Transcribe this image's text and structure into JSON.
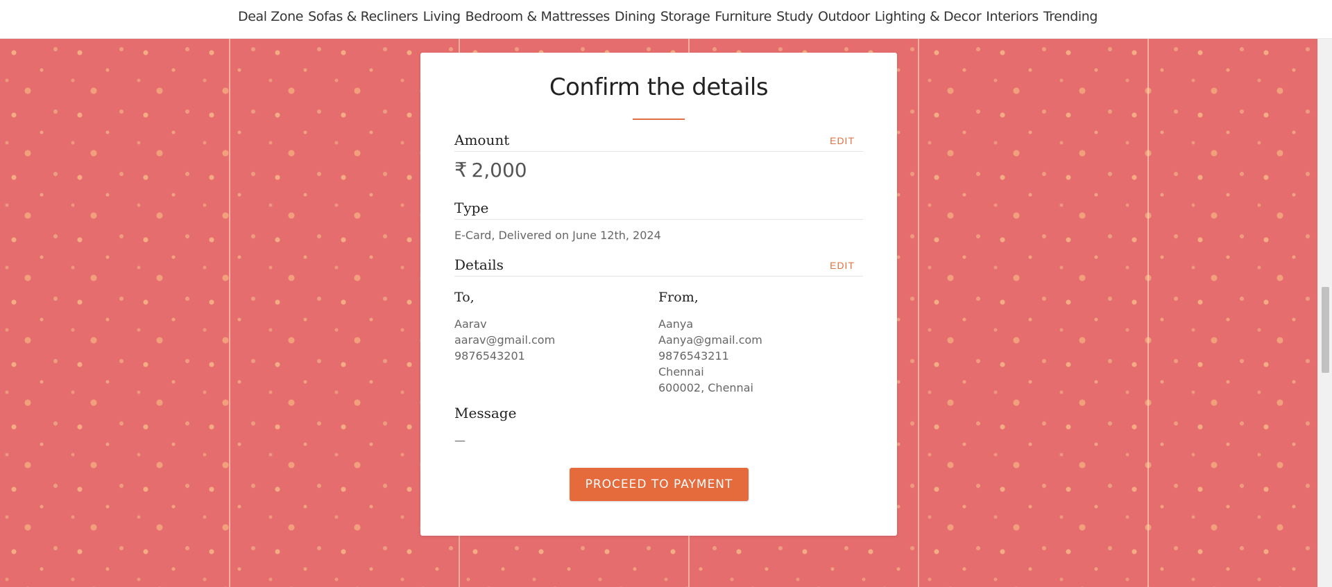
{
  "nav": {
    "items": [
      "Deal Zone",
      "Sofas & Recliners",
      "Living",
      "Bedroom & Mattresses",
      "Dining",
      "Storage",
      "Furniture",
      "Study",
      "Outdoor",
      "Lighting & Decor",
      "Interiors",
      "Trending"
    ]
  },
  "card": {
    "title": "Confirm the details",
    "amount": {
      "label": "Amount",
      "edit": "EDIT",
      "currency_symbol": "₹",
      "value": "2,000"
    },
    "type": {
      "label": "Type",
      "value": "E-Card, Delivered on June 12th, 2024"
    },
    "details": {
      "label": "Details",
      "edit": "EDIT",
      "to": {
        "heading": "To,",
        "lines": [
          "Aarav",
          "aarav@gmail.com",
          "9876543201"
        ]
      },
      "from": {
        "heading": "From,",
        "lines": [
          "Aanya",
          "Aanya@gmail.com",
          "9876543211",
          "Chennai",
          "600002, Chennai"
        ]
      }
    },
    "message": {
      "label": "Message",
      "value": "—"
    },
    "proceed_button": "PROCEED TO PAYMENT"
  },
  "colors": {
    "accent": "#e0703f",
    "button": "#e56a3c",
    "background": "#e56d6d"
  }
}
